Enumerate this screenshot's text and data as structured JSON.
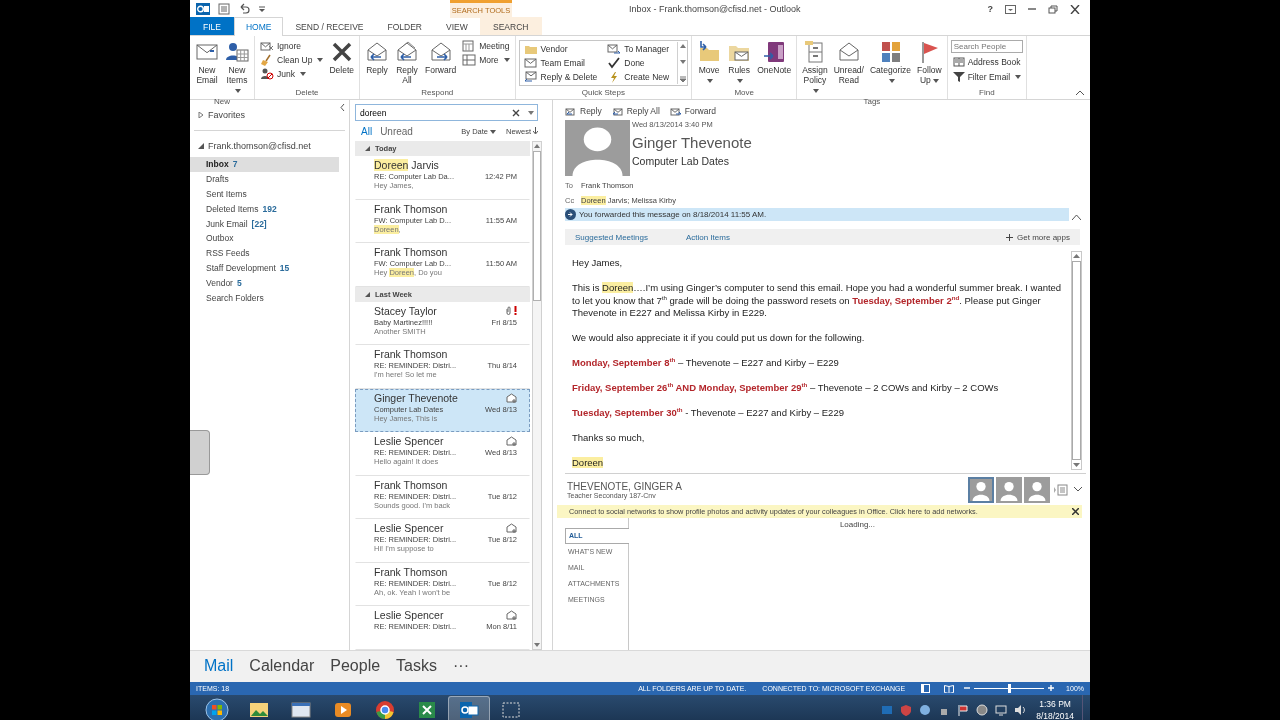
{
  "title_bar": {
    "contextual_group": "SEARCH TOOLS",
    "title": "Inbox - Frank.thomson@cfisd.net - Outlook",
    "help": "?"
  },
  "tabs": [
    {
      "label": "FILE",
      "kind": "file",
      "selected": false
    },
    {
      "label": "HOME",
      "kind": "normal",
      "selected": true
    },
    {
      "label": "SEND / RECEIVE",
      "kind": "normal",
      "selected": false
    },
    {
      "label": "FOLDER",
      "kind": "normal",
      "selected": false
    },
    {
      "label": "VIEW",
      "kind": "normal",
      "selected": false
    },
    {
      "label": "SEARCH",
      "kind": "contextual",
      "selected": false
    }
  ],
  "ribbon": {
    "groups": [
      {
        "name": "New",
        "items": [
          {
            "kind": "large",
            "label": "New Email",
            "menu": false
          },
          {
            "kind": "large",
            "label": "New Items",
            "menu": true
          }
        ]
      },
      {
        "name": "Delete",
        "items": [
          {
            "kind": "stack",
            "entries": [
              {
                "label": "Ignore",
                "menu": false
              },
              {
                "label": "Clean Up",
                "menu": true
              },
              {
                "label": "Junk",
                "menu": true
              }
            ]
          },
          {
            "kind": "large",
            "label": "Delete",
            "menu": false
          }
        ]
      },
      {
        "name": "Respond",
        "items": [
          {
            "kind": "large",
            "label": "Reply",
            "menu": false
          },
          {
            "kind": "large",
            "label": "Reply All",
            "menu": false
          },
          {
            "kind": "large",
            "label": "Forward",
            "menu": false
          },
          {
            "kind": "stack",
            "entries": [
              {
                "label": "Meeting",
                "menu": false
              },
              {
                "label": "More",
                "menu": true
              }
            ]
          }
        ]
      },
      {
        "name": "Quick Steps",
        "items": [
          {
            "kind": "gallery",
            "entries": [
              {
                "label": "Vendor"
              },
              {
                "label": "To Manager"
              },
              {
                "label": "Team Email"
              },
              {
                "label": "Done"
              },
              {
                "label": "Reply & Delete"
              },
              {
                "label": "Create New"
              }
            ]
          }
        ]
      },
      {
        "name": "Move",
        "items": [
          {
            "kind": "large",
            "label": "Move",
            "menu": true
          },
          {
            "kind": "large",
            "label": "Rules",
            "menu": true
          },
          {
            "kind": "large",
            "label": "OneNote",
            "menu": false
          }
        ]
      },
      {
        "name": "Tags",
        "items": [
          {
            "kind": "large",
            "label": "Assign Policy",
            "menu": true
          },
          {
            "kind": "large",
            "label": "Unread/ Read",
            "menu": false
          },
          {
            "kind": "large",
            "label": "Categorize",
            "menu": true
          },
          {
            "kind": "large",
            "label": "Follow Up",
            "menu": true
          }
        ]
      },
      {
        "name": "Find",
        "items": [
          {
            "kind": "find",
            "placeholder": "Search People",
            "entries": [
              {
                "label": "Address Book",
                "menu": false
              },
              {
                "label": "Filter Email",
                "menu": true
              }
            ]
          }
        ]
      }
    ]
  },
  "folder_pane": {
    "favorites": {
      "label": "Favorites",
      "expanded": false
    },
    "account": {
      "label": "Frank.thomson@cfisd.net",
      "expanded": true
    },
    "folders": [
      {
        "name": "Inbox",
        "count": "7",
        "selected": true
      },
      {
        "name": "Drafts",
        "selected": false
      },
      {
        "name": "Sent Items",
        "selected": false
      },
      {
        "name": "Deleted Items",
        "count": "192",
        "selected": false
      },
      {
        "name": "Junk Email",
        "count": "[22]",
        "selected": false
      },
      {
        "name": "Outbox",
        "selected": false
      },
      {
        "name": "RSS Feeds",
        "selected": false
      },
      {
        "name": "Staff Development",
        "count": "15",
        "selected": false
      },
      {
        "name": "Vendor",
        "count": "5",
        "selected": false
      },
      {
        "name": "Search Folders",
        "selected": false
      }
    ]
  },
  "message_list": {
    "search": {
      "value": "doreen"
    },
    "filters": [
      {
        "label": "All",
        "selected": true
      },
      {
        "label": "Unread",
        "selected": false
      }
    ],
    "sort": "By Date",
    "order": "Newest",
    "groups": [
      {
        "label": "Today",
        "expanded": true,
        "items": [
          {
            "sender": [
              {
                "text": "Doreen",
                "kind": "highlight"
              },
              {
                "text": " Jarvis",
                "kind": "plain"
              }
            ],
            "subject": "RE: Computer Lab Da...",
            "date": "12:42 PM",
            "preview": [
              {
                "text": "Hey James,",
                "kind": "plain"
              }
            ],
            "attachment": false,
            "important": false,
            "meeting": false,
            "selected": false
          },
          {
            "sender": [
              {
                "text": "Frank Thomson",
                "kind": "plain"
              }
            ],
            "subject": "FW: Computer Lab D...",
            "date": "11:55 AM",
            "preview": [
              {
                "text": "Doreen",
                "kind": "highlight"
              },
              {
                "text": ",",
                "kind": "plain"
              }
            ],
            "attachment": false,
            "important": false,
            "meeting": false,
            "selected": false
          },
          {
            "sender": [
              {
                "text": "Frank Thomson",
                "kind": "plain"
              }
            ],
            "subject": "FW: Computer Lab D...",
            "date": "11:50 AM",
            "preview": [
              {
                "text": "Hey ",
                "kind": "plain"
              },
              {
                "text": "Doreen",
                "kind": "highlight"
              },
              {
                "text": ",  Do you",
                "kind": "plain"
              }
            ],
            "attachment": false,
            "important": false,
            "meeting": false,
            "selected": false
          }
        ]
      },
      {
        "label": "Last Week",
        "expanded": true,
        "items": [
          {
            "sender": [
              {
                "text": "Stacey Taylor",
                "kind": "plain"
              }
            ],
            "subject": "Baby Martinez!!!!!",
            "date": "Fri 8/15",
            "preview": [
              {
                "text": "Another SMITH",
                "kind": "plain"
              }
            ],
            "attachment": true,
            "important": true,
            "meeting": false,
            "selected": false
          },
          {
            "sender": [
              {
                "text": "Frank Thomson",
                "kind": "plain"
              }
            ],
            "subject": "RE: REMINDER: Distri...",
            "date": "Thu 8/14",
            "preview": [
              {
                "text": "I'm here! So let me",
                "kind": "plain"
              }
            ],
            "attachment": false,
            "important": false,
            "meeting": false,
            "selected": false
          },
          {
            "sender": [
              {
                "text": "Ginger Thevenote",
                "kind": "plain"
              }
            ],
            "subject": "Computer Lab Dates",
            "date": "Wed 8/13",
            "preview": [
              {
                "text": "Hey James,  This is",
                "kind": "plain"
              }
            ],
            "attachment": false,
            "important": false,
            "meeting": true,
            "selected": true
          },
          {
            "sender": [
              {
                "text": "Leslie Spencer",
                "kind": "plain"
              }
            ],
            "subject": "RE: REMINDER: Distri...",
            "date": "Wed 8/13",
            "preview": [
              {
                "text": "Hello again!  It does",
                "kind": "plain"
              }
            ],
            "attachment": false,
            "important": false,
            "meeting": true,
            "selected": false
          },
          {
            "sender": [
              {
                "text": "Frank Thomson",
                "kind": "plain"
              }
            ],
            "subject": "RE: REMINDER: Distri...",
            "date": "Tue 8/12",
            "preview": [
              {
                "text": "Sounds good. I'm back",
                "kind": "plain"
              }
            ],
            "attachment": false,
            "important": false,
            "meeting": false,
            "selected": false
          },
          {
            "sender": [
              {
                "text": "Leslie Spencer",
                "kind": "plain"
              }
            ],
            "subject": "RE: REMINDER: Distri...",
            "date": "Tue 8/12",
            "preview": [
              {
                "text": "Hi!  I'm suppose to",
                "kind": "plain"
              }
            ],
            "attachment": false,
            "important": false,
            "meeting": true,
            "selected": false
          },
          {
            "sender": [
              {
                "text": "Frank Thomson",
                "kind": "plain"
              }
            ],
            "subject": "RE: REMINDER: Distri...",
            "date": "Tue 8/12",
            "preview": [
              {
                "text": "Ah, ok. Yeah I won't be",
                "kind": "plain"
              }
            ],
            "attachment": false,
            "important": false,
            "meeting": false,
            "selected": false
          },
          {
            "sender": [
              {
                "text": "Leslie Spencer",
                "kind": "plain"
              }
            ],
            "subject": "RE: REMINDER: Distri...",
            "date": "Mon 8/11",
            "attachment": false,
            "important": false,
            "meeting": true,
            "selected": false
          }
        ]
      }
    ]
  },
  "reading_pane": {
    "actions": [
      {
        "label": "Reply"
      },
      {
        "label": "Reply All"
      },
      {
        "label": "Forward"
      }
    ],
    "date": "Wed 8/13/2014 3:40 PM",
    "sender": "Ginger Thevenote",
    "subject": "Computer Lab Dates",
    "to_label": "To",
    "to": [
      {
        "text": "Frank Thomson",
        "kind": "plain"
      }
    ],
    "cc_label": "Cc",
    "cc": [
      {
        "text": "Doreen",
        "kind": "highlight"
      },
      {
        "text": " Jarvis; Melissa Kirby",
        "kind": "plain"
      }
    ],
    "info": "You forwarded this message on 8/18/2014 11:55 AM.",
    "apps": [
      {
        "label": "Suggested Meetings"
      },
      {
        "label": "Action Items"
      }
    ],
    "get_apps": "Get more apps",
    "body": [
      [
        {
          "text": "Hey James,",
          "kind": "plain"
        }
      ],
      [
        {
          "text": "This is ",
          "kind": "plain"
        },
        {
          "text": "Doreen",
          "kind": "highlight"
        },
        {
          "text": "….I’m using Ginger’s computer to send this email.  Hope you had a wonderful summer break.  I wanted to let you know that 7$^{th}$ grade will be doing the password resets on ",
          "kind": "plain"
        },
        {
          "text": "Tuesday, September 2$^{nd}$",
          "kind": "date"
        },
        {
          "text": ".  Please put Ginger Thevenote in E227 and Melissa Kirby in E229.",
          "kind": "plain"
        }
      ],
      [
        {
          "text": "We would also appreciate it if you could put us down for the following.",
          "kind": "plain"
        }
      ],
      [
        {
          "text": "Monday, September 8$^{th}$",
          "kind": "date"
        },
        {
          "text": " – Thevenote – E227 and Kirby – E229",
          "kind": "plain"
        }
      ],
      [
        {
          "text": "Friday, September 26$^{th}$ AND Monday, Spetember 29$^{th}$",
          "kind": "date"
        },
        {
          "text": " – Thevenote – 2 COWs and Kirby – 2 COWs",
          "kind": "plain"
        }
      ],
      [
        {
          "text": "Tuesday, September 30$^{th}$",
          "kind": "date"
        },
        {
          "text": " - Thevenote – E227 and Kirby – E229",
          "kind": "plain"
        }
      ],
      [
        {
          "text": "Thanks so much,",
          "kind": "plain"
        }
      ],
      [
        {
          "text": "Doreen",
          "kind": "highlight"
        }
      ]
    ],
    "people": {
      "name": "THEVENOTE, GINGER A",
      "title": "Teacher Secondary 187-Cnv",
      "avatars": [
        {
          "selected": true
        },
        {
          "selected": false
        },
        {
          "selected": false
        }
      ],
      "notice": "Connect to social networks to show profile photos and activity updates of your colleagues in Office. Click here to add networks.",
      "tabs": [
        {
          "label": "ALL",
          "selected": true
        },
        {
          "label": "WHAT'S NEW",
          "selected": false
        },
        {
          "label": "MAIL",
          "selected": false
        },
        {
          "label": "ATTACHMENTS",
          "selected": false
        },
        {
          "label": "MEETINGS",
          "selected": false
        }
      ],
      "loading": "Loading..."
    }
  },
  "nav_bar": {
    "items": [
      {
        "label": "Mail",
        "selected": true
      },
      {
        "label": "Calendar",
        "selected": false
      },
      {
        "label": "People",
        "selected": false
      },
      {
        "label": "Tasks",
        "selected": false
      }
    ],
    "more": "···"
  },
  "status_bar": {
    "items": "ITEMS: 18",
    "sync": "ALL FOLDERS ARE UP TO DATE.",
    "connection": "CONNECTED TO: MICROSOFT EXCHANGE",
    "zoom": {
      "level": 0.5,
      "reading": "100%"
    }
  },
  "taskbar": {
    "time": "1:36 PM",
    "date": "8/18/2014"
  }
}
